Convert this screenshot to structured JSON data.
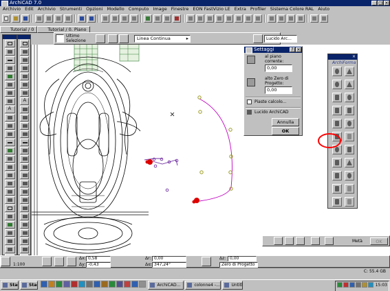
{
  "app": {
    "title": "ArchiCAD",
    "version_title": "ArchiCAD 7.0"
  },
  "menu": [
    "Archivio",
    "Edit",
    "Archivio",
    "Strumenti",
    "Opzioni",
    "Modello",
    "Computo",
    "Image",
    "Finestre",
    "EON FastVizio LE",
    "Extra",
    "Profiler",
    "Sistema Colore RAL",
    "Aiuto"
  ],
  "tabs": {
    "tab1": "Tutorial / 0",
    "tab2": "Tutorial / 0. Piano"
  },
  "info_box": {
    "mode_line1": "Ultimo",
    "mode_line2": "Selezione",
    "line_type": "Linea Continua",
    "layer": "Lucido Arc..."
  },
  "settings_dialog": {
    "title": "Settaggi",
    "to_current_floor_l1": "al piano",
    "to_current_floor_l2": "corrente:",
    "to_current_floor_value": "0,00",
    "project_zero_l1": "alto Zero di",
    "project_zero_l2": "Progetto:",
    "project_zero_value": "0,00",
    "slab_option": "Piaste calcolo...",
    "layer_value": "Lucido ArchiCAD",
    "cancel_label": "Annulla",
    "ok_label": "OK"
  },
  "objects_palette": {
    "title": "ArchiForma"
  },
  "coordinates": {
    "scale": "1:100",
    "ax_label": "Δx:",
    "ax_value": "0,58",
    "ay_label": "Δy:",
    "ay_value": "-0,43",
    "ar_label": "Δr:",
    "ar_value": "0,00",
    "aa_label": "Δα:",
    "aa_value": "347,24°",
    "az_label": "Δz:",
    "az_value": "0,00",
    "project_zero": "Zero di Progetto"
  },
  "control_box": {
    "label": "Metà",
    "disabled_button": "OK"
  },
  "status": {
    "disk_free": "C: 55.4 GB"
  },
  "taskbar": {
    "start1": "Start",
    "start2": "Start",
    "items": [
      "ArchiCAD...",
      "colonne4 -...",
      "Untitled..."
    ],
    "time": "15:03"
  },
  "colors": {
    "highlight_circle": "#ff0000",
    "arc": "#c000c0",
    "handles": "#9a9a20",
    "marker": "#dd0000",
    "grid_green": "#2e7d32",
    "titlebar": "#0a246a"
  }
}
